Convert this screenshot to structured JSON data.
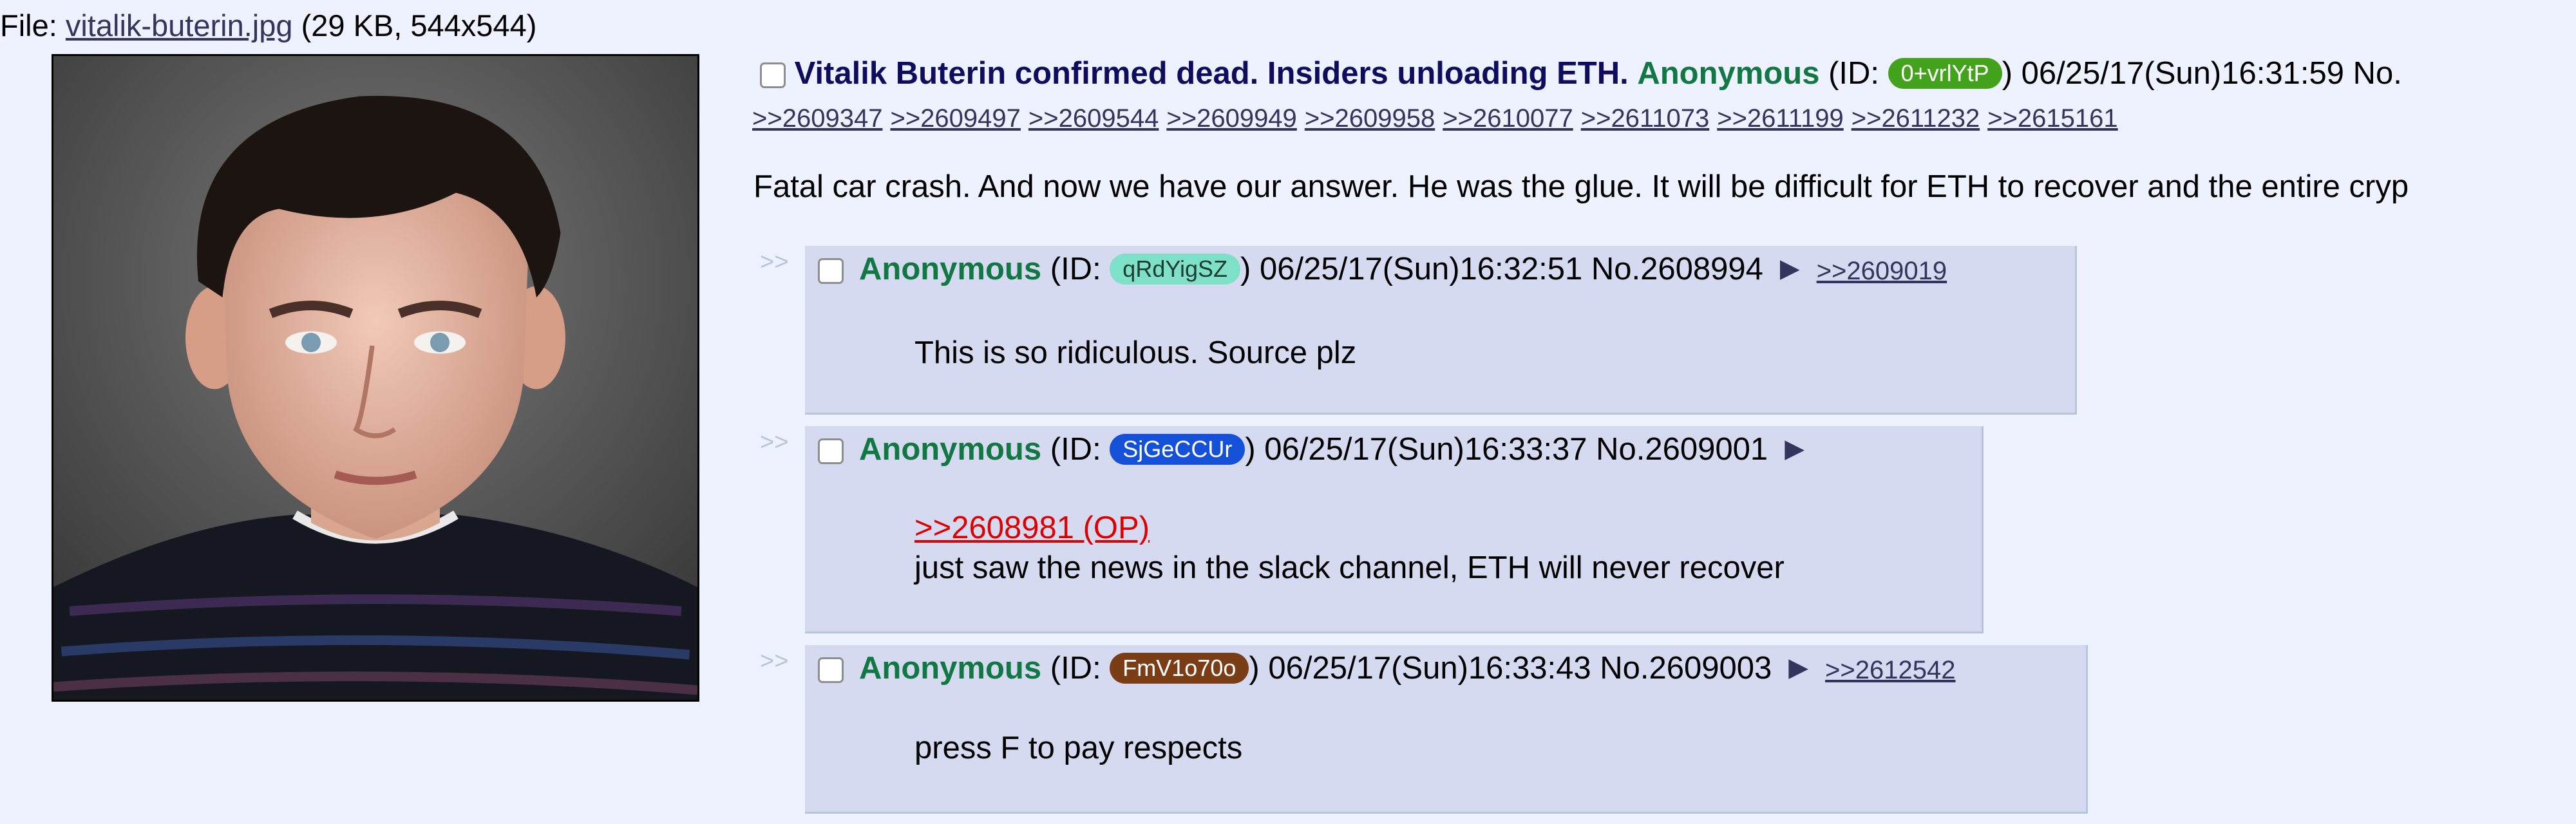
{
  "file": {
    "prefix": "File: ",
    "filename": "vitalik-buterin.jpg",
    "meta": " (29 KB, 544x544)"
  },
  "op": {
    "subject": "Vitalik Buterin confirmed dead. Insiders unloading ETH.",
    "name": "Anonymous",
    "id_prefix": "(ID: ",
    "id": "0+vrlYtP",
    "id_suffix": ")",
    "id_color": "#44a31c",
    "datetime": "06/25/17(Sun)16:31:59 No.",
    "backlinks": [
      ">>2609347",
      ">>2609497",
      ">>2609544",
      ">>2609949",
      ">>2609958",
      ">>2610077",
      ">>2611073",
      ">>2611199",
      ">>2611232",
      ">>2615161"
    ],
    "body": "Fatal car crash. And now we have our answer. He was the glue. It will be difficult for ETH to recover and the entire cryp"
  },
  "replies": [
    {
      "arrows": ">>",
      "name": "Anonymous",
      "id_prefix": "(ID: ",
      "id": "qRdYigSZ",
      "id_suffix": ")",
      "id_bg": "#7fe0c8",
      "id_fg": "#1d3d33",
      "datetime": "06/25/17(Sun)16:32:51 No.2608994",
      "backlink": ">>2609019",
      "quote": "",
      "message": "This is so ridiculous. Source plz"
    },
    {
      "arrows": ">>",
      "name": "Anonymous",
      "id_prefix": "(ID: ",
      "id": "SjGeCCUr",
      "id_suffix": ")",
      "id_bg": "#1450d8",
      "id_fg": "#ffffff",
      "datetime": "06/25/17(Sun)16:33:37 No.2609001",
      "backlink": "",
      "quote": ">>2608981 (OP)",
      "message": "just saw the news in the slack channel, ETH will never recover"
    },
    {
      "arrows": ">>",
      "name": "Anonymous",
      "id_prefix": "(ID: ",
      "id": "FmV1o70o",
      "id_suffix": ")",
      "id_bg": "#7a3d16",
      "id_fg": "#ffffff",
      "datetime": "06/25/17(Sun)16:33:43 No.2609003",
      "backlink": ">>2612542",
      "quote": "",
      "message": "press F to pay respects"
    }
  ],
  "icons": {
    "menu_triangle": "▶",
    "checkbox": "checkbox-icon"
  },
  "colors": {
    "background": "#eef2ff",
    "reply_bg": "#d6daf0",
    "name": "#117743",
    "subject": "#0f0c5d",
    "link": "#34345c",
    "op_quote": "#dd0000"
  }
}
